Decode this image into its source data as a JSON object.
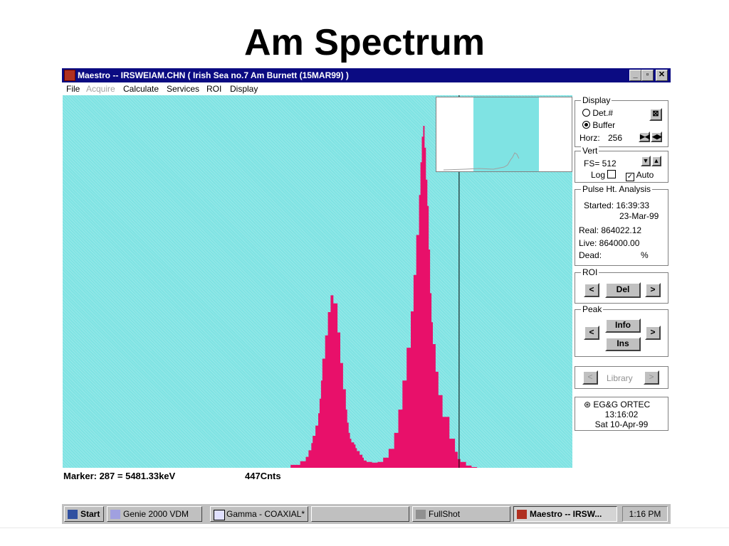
{
  "slide": {
    "title": "Am Spectrum"
  },
  "window": {
    "title": "Maestro -- IRSWEIAM.CHN ( Irish Sea no.7 Am Burnett (15MAR99) )",
    "buttons": {
      "minimize": "_",
      "restore": "▫",
      "close": "✕"
    }
  },
  "menu": [
    "File",
    "Acquire",
    "Calculate",
    "Services",
    "ROI",
    "Display"
  ],
  "status": {
    "marker": "Marker:  287  =  5481.33keV",
    "counts": "447Cnts"
  },
  "panel": {
    "display": {
      "legend": "Display",
      "det": "Det.#",
      "buffer": "Buffer",
      "horz_label": "Horz:",
      "horz_value": "256"
    },
    "vert": {
      "legend": "Vert",
      "fs": "FS= 512",
      "log": "Log",
      "auto": "Auto"
    },
    "pha": {
      "legend": "Pulse Ht. Analysis",
      "started": "Started: 16:39:33",
      "date": "23-Mar-99",
      "real": "Real:  864022.12",
      "live": "Live:  864000.00",
      "dead": "Dead:",
      "dead_val": "%"
    },
    "roi": {
      "legend": "ROI",
      "prev": "<",
      "del": "Del",
      "next": ">"
    },
    "peak": {
      "legend": "Peak",
      "prev": "<",
      "info": "Info",
      "ins": "Ins",
      "next": ">"
    },
    "library": {
      "prev": "<",
      "label": "Library",
      "next": ">"
    },
    "footer": {
      "vendor": "EG&G ORTEC",
      "time": "13:16:02",
      "date": "Sat  10-Apr-99"
    }
  },
  "taskbar": {
    "start": "Start",
    "tasks": [
      "Genie 2000 VDM",
      "Gamma - COAXIAL*",
      "",
      "FullShot",
      "Maestro -- IRSW..."
    ],
    "clock": "1:16 PM"
  },
  "chart_data": {
    "type": "area",
    "title": "",
    "xlabel": "",
    "ylabel": "",
    "xlim": [
      0,
      369
    ],
    "ylim": [
      0,
      512
    ],
    "marker_channel": 287,
    "series": [
      {
        "x": [
          0,
          160,
          165,
          172,
          176,
          178,
          180,
          181,
          183,
          185,
          186,
          187,
          188,
          190,
          192,
          194,
          196,
          199,
          201,
          203,
          205,
          206,
          207,
          208,
          209,
          211,
          212,
          213,
          215,
          217,
          218,
          220,
          224,
          228,
          232,
          236,
          240,
          243,
          246,
          249,
          252,
          254,
          256,
          258,
          259,
          260,
          261,
          262,
          263,
          264,
          265,
          266,
          267,
          268,
          270,
          272,
          275,
          280,
          284,
          286,
          288,
          292,
          296,
          300,
          369
        ],
        "y": [
          0,
          0,
          4,
          9,
          15,
          24,
          34,
          44,
          58,
          75,
          95,
          120,
          150,
          182,
          214,
          237,
          226,
          186,
          144,
          108,
          80,
          62,
          48,
          40,
          35,
          32,
          27,
          23,
          18,
          14,
          10,
          8,
          7,
          8,
          14,
          26,
          48,
          80,
          120,
          165,
          215,
          265,
          320,
          375,
          420,
          455,
          470,
          440,
          396,
          360,
          300,
          240,
          200,
          170,
          132,
          100,
          70,
          40,
          22,
          12,
          8,
          3,
          1,
          0,
          0
        ]
      }
    ]
  }
}
